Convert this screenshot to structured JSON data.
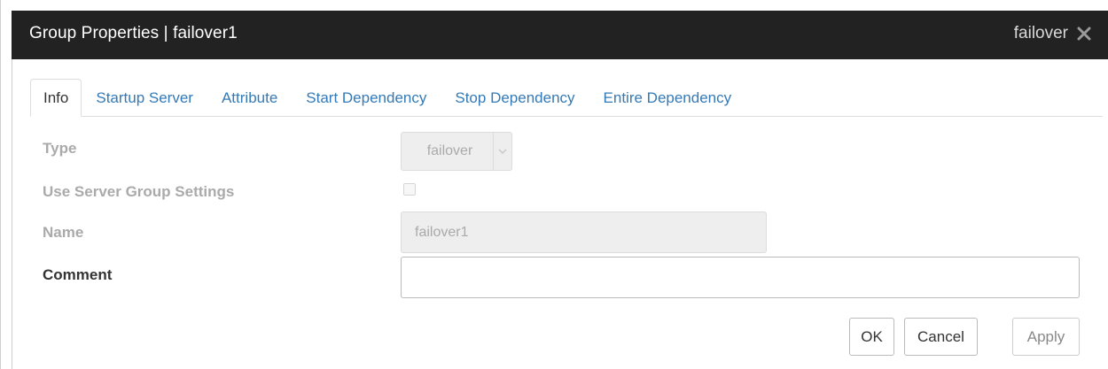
{
  "dialog": {
    "title": "Group Properties | failover1",
    "group_type": "failover",
    "close_icon": "close-icon"
  },
  "tabs": [
    {
      "label": "Info",
      "active": true
    },
    {
      "label": "Startup Server",
      "active": false
    },
    {
      "label": "Attribute",
      "active": false
    },
    {
      "label": "Start Dependency",
      "active": false
    },
    {
      "label": "Stop Dependency",
      "active": false
    },
    {
      "label": "Entire Dependency",
      "active": false
    }
  ],
  "form": {
    "type_label": "Type",
    "type_value": "failover",
    "use_server_group_label": "Use Server Group Settings",
    "use_server_group_checked": false,
    "name_label": "Name",
    "name_value": "failover1",
    "comment_label": "Comment",
    "comment_value": ""
  },
  "buttons": {
    "ok": "OK",
    "cancel": "Cancel",
    "apply": "Apply"
  },
  "colors": {
    "titlebar": "#222222",
    "tab_link": "#337ab7",
    "disabled_text": "#aaaaaa"
  }
}
